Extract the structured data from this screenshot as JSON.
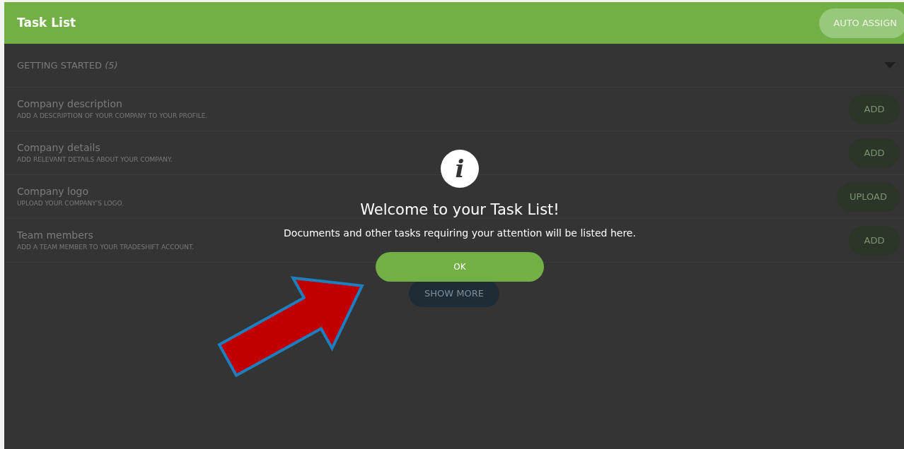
{
  "header": {
    "title": "Task List",
    "auto_assign": "AUTO ASSIGN"
  },
  "section": {
    "title": "GETTING STARTED *(5)*",
    "expanded": true
  },
  "tasks": [
    {
      "title": "Company description",
      "description": "ADD A DESCRIPTION OF YOUR COMPANY TO YOUR PROFILE.",
      "action": "ADD"
    },
    {
      "title": "Company details",
      "description": "ADD RELEVANT DETAILS ABOUT YOUR COMPANY.",
      "action": "ADD"
    },
    {
      "title": "Company logo",
      "description": "UPLOAD YOUR COMPANY'S LOGO.",
      "action": "UPLOAD"
    },
    {
      "title": "Team members",
      "description": "ADD A TEAM MEMBER TO YOUR TRADESHIFT ACCOUNT.",
      "action": "ADD"
    }
  ],
  "show_more": "SHOW MORE",
  "dialog": {
    "icon": "i",
    "title": "Welcome to your Task List!",
    "message": "Documents and other tasks requiring your attention will be listed here.",
    "ok": "OK"
  }
}
